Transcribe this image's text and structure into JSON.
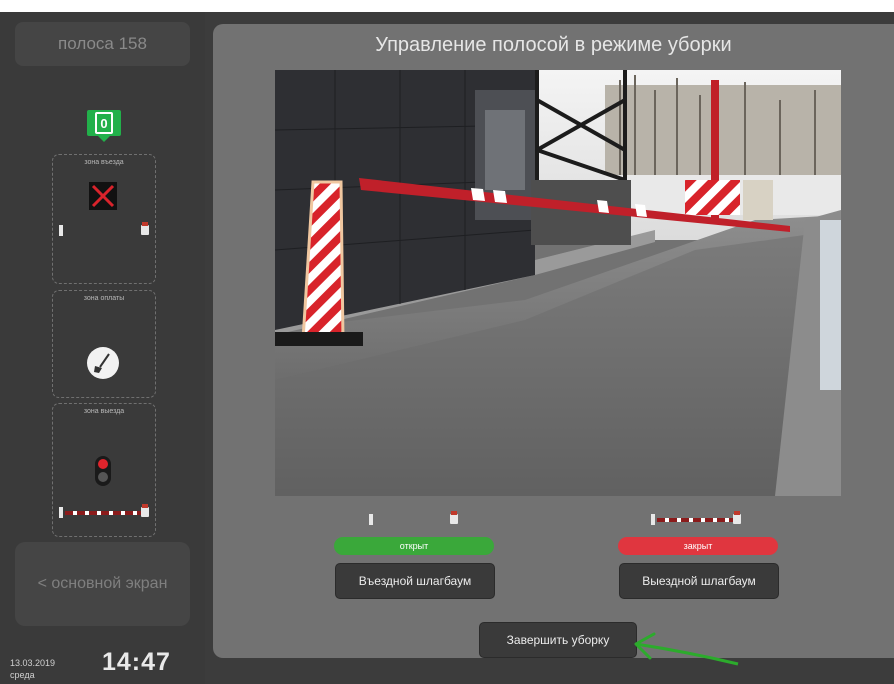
{
  "sidebar": {
    "lane_title": "полоса 158",
    "marker_value": "0",
    "zones": [
      {
        "label": "зона въезда"
      },
      {
        "label": "зона оплаты"
      },
      {
        "label": "зона выезда"
      }
    ],
    "back_button": "< основной экран",
    "date": "13.03.2019",
    "weekday": "среда",
    "time": "14:47"
  },
  "main": {
    "title": "Управление полосой в режиме уборки",
    "left_barrier": {
      "status": "открыт",
      "status_color": "#3aa83a",
      "button": "Въездной шлагбаум"
    },
    "right_barrier": {
      "status": "закрыт",
      "status_color": "#e0363f",
      "button": "Выездной шлагбаум"
    },
    "finish_button": "Завершить уборку"
  },
  "colors": {
    "accent_green": "#22b04a",
    "annotation_arrow": "#2cab2c",
    "barrier_red": "#c0202a"
  }
}
